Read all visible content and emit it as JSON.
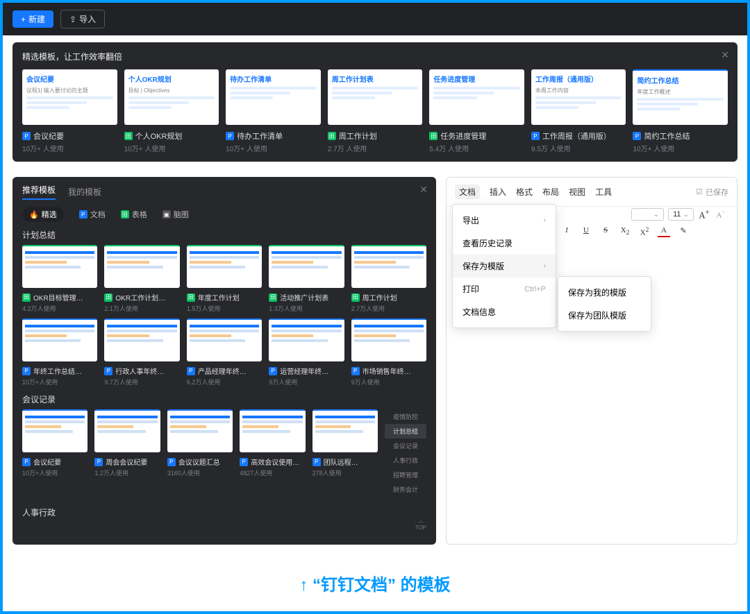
{
  "toolbar": {
    "new": "新建",
    "import": "导入"
  },
  "banner": {
    "title": "精选模板，让工作效率翻倍",
    "cards": [
      {
        "title": "会议纪要",
        "name": "会议纪要",
        "usage": "10万+ 人使用",
        "icon": "doc",
        "preview_lines": [
          "会议纪要",
          "议程1| 输入要讨论的主题"
        ]
      },
      {
        "title": "个人OKR规划",
        "name": "个人OKR规划",
        "usage": "10万+ 人使用",
        "icon": "sheet",
        "preview_lines": [
          "个人OKR规划",
          "目标 | Objectives"
        ]
      },
      {
        "title": "待办工作清单",
        "name": "待办工作清单",
        "usage": "10万+ 人使用",
        "icon": "doc",
        "preview_lines": [
          "待办工作清单"
        ]
      },
      {
        "title": "周工作计划表",
        "name": "周工作计划",
        "usage": "2.7万 人使用",
        "icon": "sheet",
        "preview_lines": [
          "周工作计划表"
        ]
      },
      {
        "title": "任务进度管理",
        "name": "任务进度管理",
        "usage": "5.4万 人使用",
        "icon": "sheet",
        "preview_lines": [
          "任务进度管理"
        ]
      },
      {
        "title": "工作周报（通用版）",
        "name": "工作周报（通用版）",
        "usage": "9.5万 人使用",
        "icon": "doc",
        "preview_lines": [
          "工作周报（通用版）",
          "本周工作内容"
        ]
      },
      {
        "title": "简约工作总结",
        "name": "简约工作总结",
        "usage": "10万+ 人使用",
        "icon": "doc",
        "preview_lines": [
          "简约工作总结",
          "年度工作概述"
        ]
      }
    ]
  },
  "panel": {
    "tabs": [
      "推荐模板",
      "我的模板"
    ],
    "subtabs": [
      {
        "label": "精选",
        "icon": "fire"
      },
      {
        "label": "文档",
        "icon": "doc"
      },
      {
        "label": "表格",
        "icon": "sheet"
      },
      {
        "label": "脑图",
        "icon": "mind"
      }
    ],
    "sections": [
      {
        "title": "计划总结",
        "cards": [
          {
            "name": "OKR目标管理…",
            "usage": "4.2万人使用",
            "icon": "sheet",
            "border": "green"
          },
          {
            "name": "OKR工作计划…",
            "usage": "2.1万人使用",
            "icon": "sheet",
            "border": "green"
          },
          {
            "name": "年度工作计划",
            "usage": "1.5万人使用",
            "icon": "sheet",
            "border": "green"
          },
          {
            "name": "活动推广计划表",
            "usage": "1.3万人使用",
            "icon": "sheet",
            "border": "green"
          },
          {
            "name": "周工作计划",
            "usage": "2.7万人使用",
            "icon": "sheet",
            "border": "green"
          }
        ]
      },
      {
        "title": "",
        "cards": [
          {
            "name": "年终工作总结…",
            "usage": "10万+人使用",
            "icon": "doc",
            "border": "blue"
          },
          {
            "name": "行政人事年终…",
            "usage": "9.7万人使用",
            "icon": "doc",
            "border": "blue"
          },
          {
            "name": "产品经理年终…",
            "usage": "6.2万人使用",
            "icon": "doc",
            "border": "blue"
          },
          {
            "name": "运营经理年终…",
            "usage": "9万人使用",
            "icon": "doc",
            "border": "blue"
          },
          {
            "name": "市场销售年终…",
            "usage": "9万人使用",
            "icon": "doc",
            "border": "blue"
          }
        ]
      }
    ],
    "section2_title": "会议记录",
    "section2_cards": [
      {
        "name": "会议纪要",
        "usage": "10万+人使用",
        "icon": "doc"
      },
      {
        "name": "周会会议纪要",
        "usage": "1.2万人使用",
        "icon": "doc"
      },
      {
        "name": "会议议题汇总",
        "usage": "3160人使用",
        "icon": "doc"
      },
      {
        "name": "高效会议使用…",
        "usage": "4827人使用",
        "icon": "doc"
      },
      {
        "name": "团队远程…",
        "usage": "278人使用",
        "icon": "doc"
      }
    ],
    "sidecats": [
      "疫情防控",
      "计划总结",
      "会议记录",
      "人事行政",
      "招聘管理",
      "财务会计"
    ],
    "sidecats_active": 1,
    "section3_title": "人事行政",
    "top_label": "TOP"
  },
  "editor": {
    "menus": [
      "文档",
      "插入",
      "格式",
      "布局",
      "视图",
      "工具"
    ],
    "saved": "已保存",
    "font_size": "11",
    "dropdown": [
      {
        "label": "导出",
        "sub": true
      },
      {
        "label": "查看历史记录"
      },
      {
        "label": "保存为模版",
        "sub": true,
        "active": true
      },
      {
        "label": "打印",
        "shortcut": "Ctrl+P"
      },
      {
        "label": "文档信息"
      }
    ],
    "submenu": [
      "保存为我的模版",
      "保存为团队模版"
    ]
  },
  "caption": "↑ “钉钉文档” 的模板"
}
